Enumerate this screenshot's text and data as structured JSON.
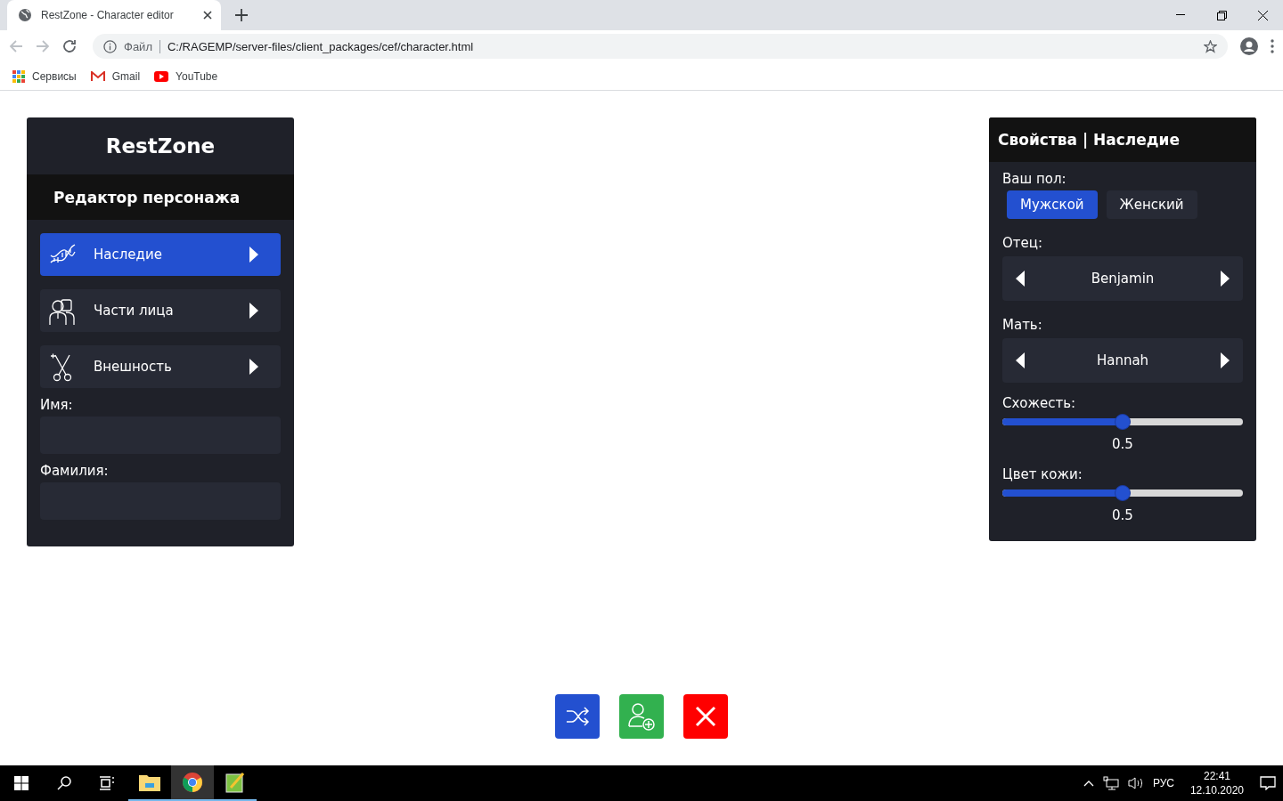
{
  "browser": {
    "tab_title": "RestZone - Character editor",
    "address_label": "Файл",
    "url": "C:/RAGEMP/server-files/client_packages/cef/character.html",
    "bookmarks": [
      {
        "kind": "apps",
        "label": "Сервисы"
      },
      {
        "kind": "gmail",
        "label": "Gmail"
      },
      {
        "kind": "youtube",
        "label": "YouTube"
      }
    ]
  },
  "editor": {
    "logo": "RestZone",
    "subtitle": "Редактор персонажа",
    "menu": [
      {
        "kind": "dna",
        "label": "Наследие",
        "selected": true
      },
      {
        "kind": "faces",
        "label": "Части лица",
        "selected": false
      },
      {
        "kind": "scissors",
        "label": "Внешность",
        "selected": false
      }
    ],
    "fields": [
      {
        "label": "Имя:"
      },
      {
        "label": "Фамилия:"
      }
    ]
  },
  "properties": {
    "title": "Свойства | Наследие",
    "gender_label": "Ваш пол:",
    "genders": [
      {
        "label": "Мужской",
        "selected": true
      },
      {
        "label": "Женский",
        "selected": false
      }
    ],
    "selectors": [
      {
        "label": "Отец:",
        "value": "Benjamin"
      },
      {
        "label": "Мать:",
        "value": "Hannah"
      }
    ],
    "sliders": [
      {
        "label": "Схожесть:",
        "level": 0.5,
        "reading": "0.5"
      },
      {
        "label": "Цвет кожи:",
        "level": 0.5,
        "reading": "0.5"
      }
    ]
  },
  "actions": [
    {
      "kind": "shuffle"
    },
    {
      "kind": "add-user"
    },
    {
      "kind": "close"
    }
  ],
  "taskbar": {
    "apps": [
      {
        "kind": "folder",
        "selected": false
      },
      {
        "kind": "chrome",
        "selected": true
      },
      {
        "kind": "notepad",
        "selected": false
      }
    ],
    "language": "РУС",
    "time": "22:41",
    "date": "12.10.2020"
  }
}
